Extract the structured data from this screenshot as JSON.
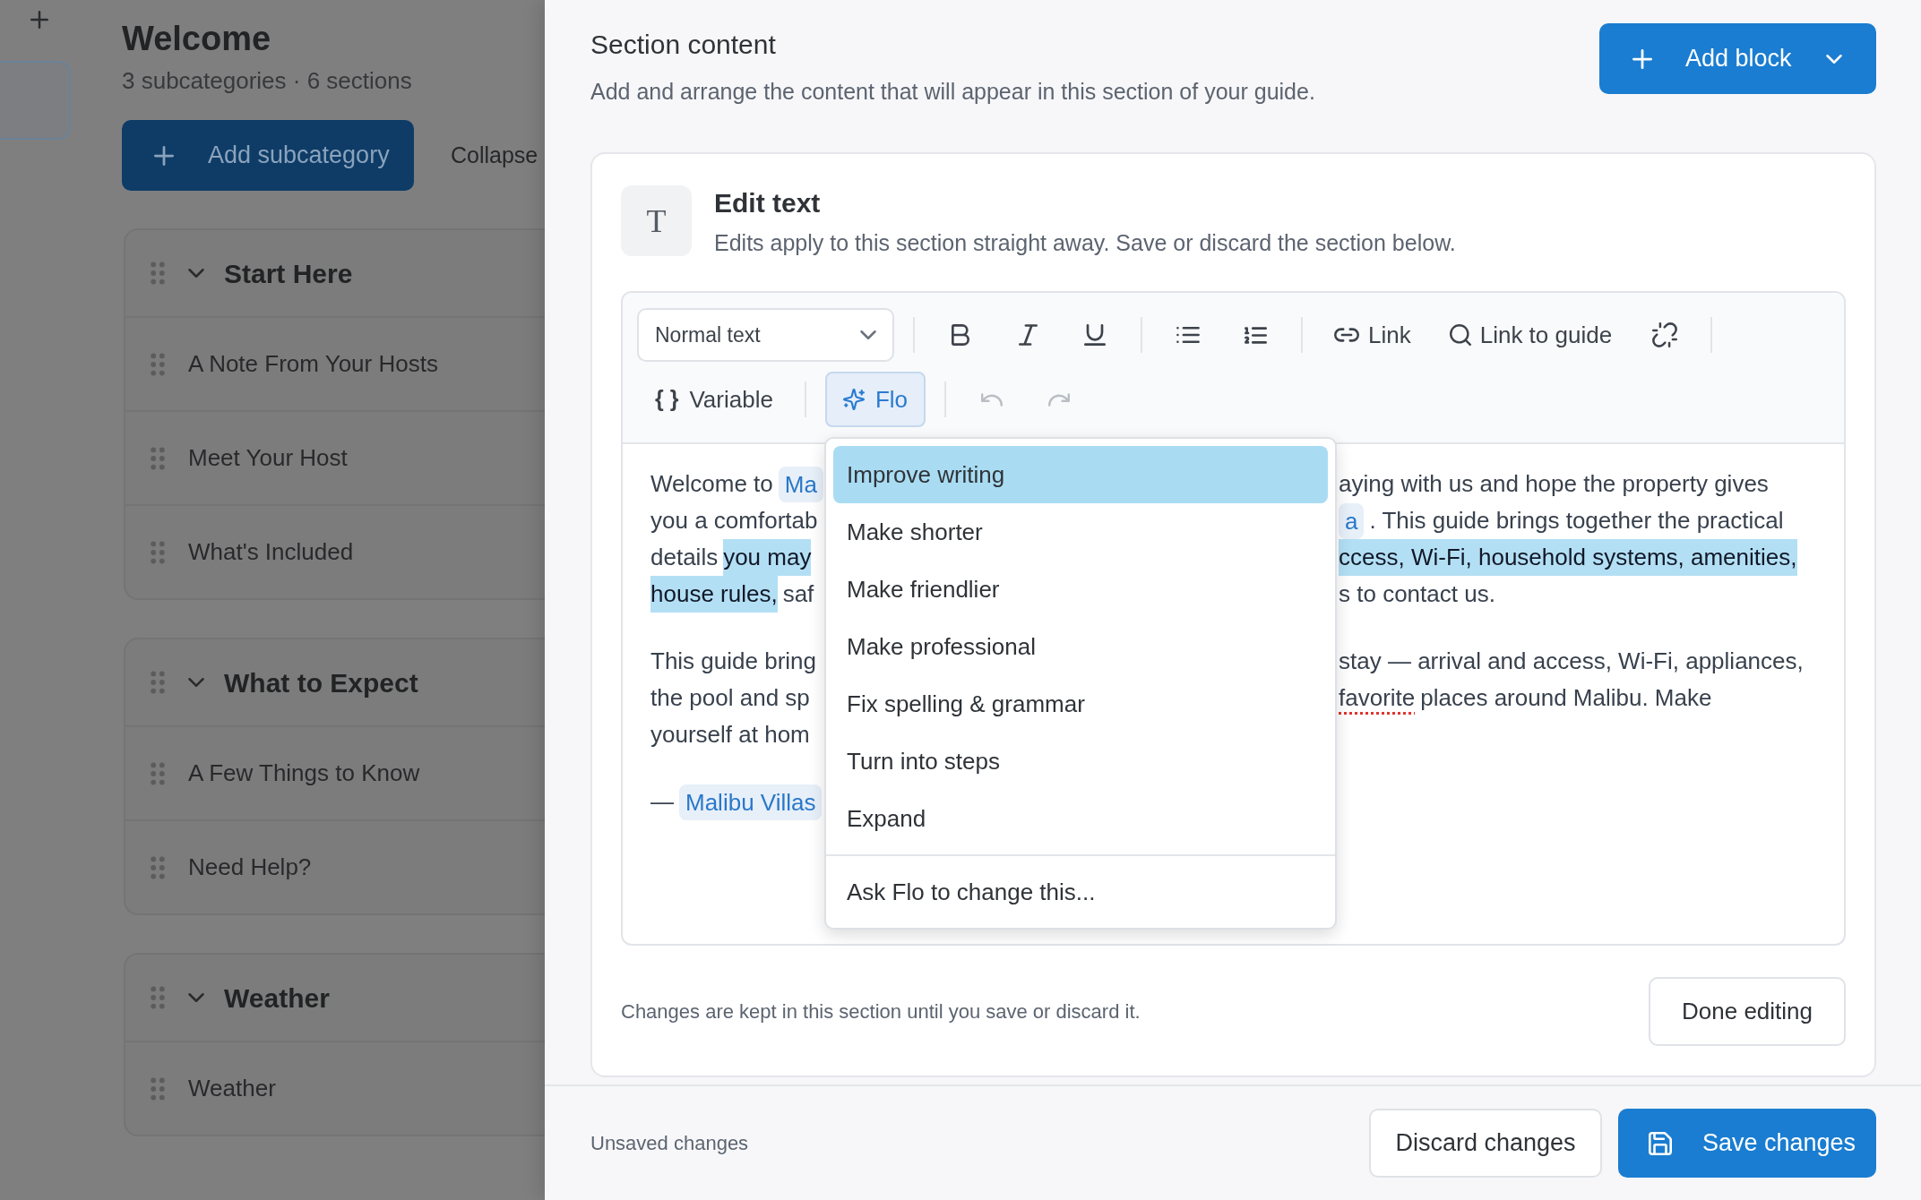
{
  "guide_outline": {
    "title": "Welcome",
    "summary": "3 subcategories · 6 sections",
    "add_subcategory_button": "Add subcategory",
    "collapse_button": "Collapse",
    "subcategories": [
      {
        "title": "Start Here",
        "expanded": true,
        "sections": [
          "A Note From Your Hosts",
          "Meet Your Host",
          "What's Included"
        ]
      },
      {
        "title": "What to Expect",
        "expanded": true,
        "sections": [
          "A Few Things to Know",
          "Need Help?"
        ]
      },
      {
        "title": "Weather",
        "expanded": true,
        "sections": [
          "Weather"
        ]
      }
    ]
  },
  "section_panel": {
    "title": "Section content",
    "subtitle": "Add and arrange the content that will appear in this section of your guide.",
    "add_block_button": "Add block",
    "block": {
      "type_letter": "T",
      "title": "Edit text",
      "subtitle": "Edits apply to this section straight away. Save or discard the section below.",
      "toolbar": {
        "rows": [
          {
            "groups": [
              {
                "tools": [
                  {
                    "kind": "style_select",
                    "label": "Normal text",
                    "disabled": false
                  }
                ]
              },
              {
                "tools": [
                  {
                    "kind": "bold",
                    "disabled": false
                  },
                  {
                    "kind": "italic",
                    "disabled": false
                  },
                  {
                    "kind": "underline",
                    "disabled": false
                  }
                ]
              },
              {
                "tools": [
                  {
                    "kind": "bullet_list",
                    "disabled": false
                  },
                  {
                    "kind": "numbered_list",
                    "disabled": false
                  }
                ]
              },
              {
                "tools": [
                  {
                    "kind": "link",
                    "label": "Link",
                    "disabled": false
                  },
                  {
                    "kind": "link_to_guide",
                    "label": "Link to guide",
                    "disabled": false
                  },
                  {
                    "kind": "unlink",
                    "disabled": false
                  }
                ]
              }
            ]
          },
          {
            "groups": [
              {
                "tools": [
                  {
                    "kind": "variable",
                    "glyph": "{ }",
                    "label": "Variable",
                    "disabled": false
                  }
                ]
              },
              {
                "tools": [
                  {
                    "kind": "flo",
                    "label": "Flo",
                    "disabled": false
                  }
                ]
              },
              {
                "tools": [
                  {
                    "kind": "undo",
                    "disabled": true
                  },
                  {
                    "kind": "redo",
                    "disabled": true
                  }
                ]
              }
            ]
          }
        ]
      },
      "content": {
        "paragraphs": [
          {
            "lines": [
              {
                "left": [
                  {
                    "kind": "plain",
                    "text": "Welcome to"
                  },
                  {
                    "kind": "chip",
                    "text": "Ma"
                  }
                ],
                "right": [
                  {
                    "kind": "plain",
                    "text": "aying with us and hope the property gives"
                  }
                ]
              },
              {
                "left": [
                  {
                    "kind": "plain",
                    "text": "you a comfortab"
                  }
                ],
                "right": [
                  {
                    "kind": "chip",
                    "text": "a"
                  },
                  {
                    "kind": "plain",
                    "text": ". This guide brings together the practical"
                  }
                ]
              },
              {
                "left": [
                  {
                    "kind": "plain",
                    "text": "details"
                  },
                  {
                    "kind": "highlight",
                    "text": "you may"
                  }
                ],
                "right": [
                  {
                    "kind": "highlight",
                    "text": "ccess, Wi-Fi, household systems, amenities,"
                  }
                ]
              },
              {
                "left": [
                  {
                    "kind": "highlight",
                    "text": "house rules,"
                  },
                  {
                    "kind": "plain",
                    "text": "saf"
                  }
                ],
                "right": [
                  {
                    "kind": "plain",
                    "text": "s to contact us."
                  }
                ]
              }
            ]
          },
          {
            "lines": [
              {
                "left": [
                  {
                    "kind": "plain",
                    "text": "This guide bring"
                  }
                ],
                "right": [
                  {
                    "kind": "plain",
                    "text": "stay — arrival and access, Wi-Fi, appliances,"
                  }
                ]
              },
              {
                "left": [
                  {
                    "kind": "plain",
                    "text": "the pool and sp"
                  }
                ],
                "right": [
                  {
                    "kind": "misspelled",
                    "text": "favorite"
                  },
                  {
                    "kind": "plain",
                    "text": "places around Malibu. Make"
                  }
                ]
              },
              {
                "left": [
                  {
                    "kind": "plain",
                    "text": "yourself at hom"
                  }
                ]
              }
            ]
          },
          {
            "lines": [
              {
                "left": [
                  {
                    "kind": "plain",
                    "text": "—"
                  },
                  {
                    "kind": "chip",
                    "text": "Malibu Villas"
                  }
                ]
              }
            ]
          }
        ]
      },
      "flo_menu": {
        "open": true,
        "items": [
          {
            "label": "Improve writing",
            "selected": true
          },
          {
            "label": "Make shorter",
            "selected": false
          },
          {
            "label": "Make friendlier",
            "selected": false
          },
          {
            "label": "Make professional",
            "selected": false
          },
          {
            "label": "Fix spelling & grammar",
            "selected": false
          },
          {
            "label": "Turn into steps",
            "selected": false
          },
          {
            "label": "Expand",
            "selected": false
          }
        ],
        "custom_prompt": "Ask Flo to change this..."
      },
      "footer_note": "Changes are kept in this section until you save or discard it.",
      "done_button": "Done editing"
    },
    "footer": {
      "status": "Unsaved changes",
      "discard_button": "Discard changes",
      "save_button": "Save changes"
    }
  }
}
